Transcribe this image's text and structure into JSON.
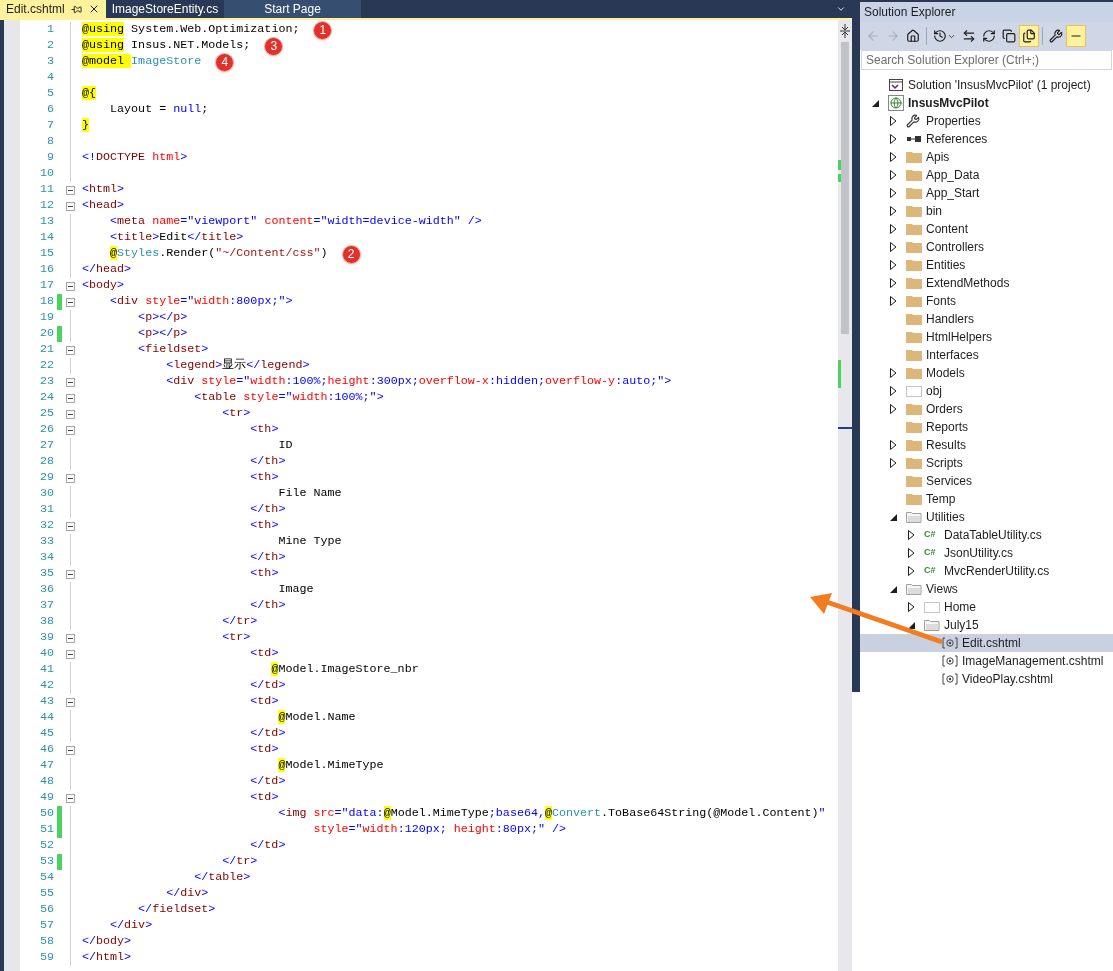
{
  "tabs": [
    {
      "label": "Edit.cshtml",
      "selected": true
    },
    {
      "label": "ImageStoreEntity.cs",
      "selected": false
    },
    {
      "label": "Start Page",
      "selected": false
    }
  ],
  "editor": {
    "lines": [
      {
        "num": "1",
        "fold": false,
        "changed": false,
        "callout": "1",
        "tokens": [
          {
            "kind": "razor",
            "text": "@using"
          },
          {
            "kind": "plain",
            "text": " System.Web.Optimization;"
          }
        ]
      },
      {
        "num": "2",
        "fold": false,
        "changed": false,
        "callout": "3",
        "tokens": [
          {
            "kind": "razor",
            "text": "@using"
          },
          {
            "kind": "plain",
            "text": " Insus.NET.Models;"
          }
        ]
      },
      {
        "num": "3",
        "fold": false,
        "changed": false,
        "callout": "4",
        "tokens": [
          {
            "kind": "razor",
            "text": "@model "
          },
          {
            "kind": "type",
            "text": "ImageStore"
          }
        ]
      },
      {
        "num": "4",
        "fold": false,
        "changed": false
      },
      {
        "num": "5",
        "fold": false,
        "changed": false,
        "tokens": [
          {
            "kind": "razor",
            "text": "@{"
          }
        ]
      },
      {
        "num": "6",
        "fold": false,
        "changed": false,
        "tokens": [
          {
            "kind": "plain",
            "text": "    Layout = "
          },
          {
            "kind": "keyword",
            "text": "null"
          },
          {
            "kind": "plain",
            "text": ";"
          }
        ]
      },
      {
        "num": "7",
        "fold": false,
        "changed": false,
        "tokens": [
          {
            "kind": "razor",
            "text": "}"
          }
        ]
      },
      {
        "num": "8",
        "fold": false,
        "changed": false
      },
      {
        "num": "9",
        "fold": false,
        "changed": false,
        "tokens": [
          {
            "kind": "punct",
            "text": "<!"
          },
          {
            "kind": "element",
            "text": "DOCTYPE"
          },
          {
            "kind": "attr",
            "text": " html"
          },
          {
            "kind": "punct",
            "text": ">"
          }
        ]
      },
      {
        "num": "10",
        "fold": false,
        "changed": false
      },
      {
        "num": "11",
        "fold": true,
        "changed": false,
        "tokens": [
          {
            "kind": "punct",
            "text": "<"
          },
          {
            "kind": "element",
            "text": "html"
          },
          {
            "kind": "punct",
            "text": ">"
          }
        ]
      },
      {
        "num": "12",
        "fold": true,
        "changed": false,
        "tokens": [
          {
            "kind": "punct",
            "text": "<"
          },
          {
            "kind": "element",
            "text": "head"
          },
          {
            "kind": "punct",
            "text": ">"
          }
        ]
      },
      {
        "num": "13",
        "fold": false,
        "changed": false,
        "tokens": [
          {
            "kind": "punct",
            "text": "    <"
          },
          {
            "kind": "element",
            "text": "meta"
          },
          {
            "kind": "attr",
            "text": " name"
          },
          {
            "kind": "punct",
            "text": "="
          },
          {
            "kind": "value",
            "text": "\"viewport\""
          },
          {
            "kind": "attr",
            "text": " content"
          },
          {
            "kind": "punct",
            "text": "="
          },
          {
            "kind": "value",
            "text": "\"width=device-width\""
          },
          {
            "kind": "punct",
            "text": " />"
          }
        ]
      },
      {
        "num": "14",
        "fold": false,
        "changed": false,
        "tokens": [
          {
            "kind": "punct",
            "text": "    <"
          },
          {
            "kind": "element",
            "text": "title"
          },
          {
            "kind": "punct",
            "text": ">"
          },
          {
            "kind": "plain",
            "text": "Edit"
          },
          {
            "kind": "punct",
            "text": "</"
          },
          {
            "kind": "element",
            "text": "title"
          },
          {
            "kind": "punct",
            "text": ">"
          }
        ]
      },
      {
        "num": "15",
        "fold": false,
        "changed": false,
        "callout": "2",
        "tokens": [
          {
            "kind": "razor",
            "text": "    @"
          },
          {
            "kind": "type",
            "text": "Styles"
          },
          {
            "kind": "plain",
            "text": ".Render("
          },
          {
            "kind": "string",
            "text": "\"~/Content/css\""
          },
          {
            "kind": "plain",
            "text": ")"
          }
        ]
      },
      {
        "num": "16",
        "fold": false,
        "changed": false,
        "tokens": [
          {
            "kind": "punct",
            "text": "</"
          },
          {
            "kind": "element",
            "text": "head"
          },
          {
            "kind": "punct",
            "text": ">"
          }
        ]
      },
      {
        "num": "17",
        "fold": true,
        "changed": false,
        "tokens": [
          {
            "kind": "punct",
            "text": "<"
          },
          {
            "kind": "element",
            "text": "body"
          },
          {
            "kind": "punct",
            "text": ">"
          }
        ]
      },
      {
        "num": "18",
        "fold": true,
        "changed": true,
        "tokens": [
          {
            "kind": "punct",
            "text": "    <"
          },
          {
            "kind": "element",
            "text": "div"
          },
          {
            "kind": "attr",
            "text": " style"
          },
          {
            "kind": "punct",
            "text": "="
          },
          {
            "kind": "value",
            "text": "\""
          },
          {
            "kind": "attr",
            "text": "width"
          },
          {
            "kind": "value",
            "text": ":800px;\""
          },
          {
            "kind": "punct",
            "text": ">"
          }
        ]
      },
      {
        "num": "19",
        "fold": false,
        "changed": false,
        "tokens": [
          {
            "kind": "punct",
            "text": "        <"
          },
          {
            "kind": "element",
            "text": "p"
          },
          {
            "kind": "punct",
            "text": "></"
          },
          {
            "kind": "element",
            "text": "p"
          },
          {
            "kind": "punct",
            "text": ">"
          }
        ]
      },
      {
        "num": "20",
        "fold": false,
        "changed": true,
        "tokens": [
          {
            "kind": "punct",
            "text": "        <"
          },
          {
            "kind": "element",
            "text": "p"
          },
          {
            "kind": "punct",
            "text": "></"
          },
          {
            "kind": "element",
            "text": "p"
          },
          {
            "kind": "punct",
            "text": ">"
          }
        ]
      },
      {
        "num": "21",
        "fold": true,
        "changed": false,
        "tokens": [
          {
            "kind": "punct",
            "text": "        <"
          },
          {
            "kind": "element",
            "text": "fieldset"
          },
          {
            "kind": "punct",
            "text": ">"
          }
        ]
      },
      {
        "num": "22",
        "fold": false,
        "changed": false,
        "tokens": [
          {
            "kind": "punct",
            "text": "            <"
          },
          {
            "kind": "element",
            "text": "legend"
          },
          {
            "kind": "punct",
            "text": ">"
          },
          {
            "kind": "plain",
            "text": "显示"
          },
          {
            "kind": "punct",
            "text": "</"
          },
          {
            "kind": "element",
            "text": "legend"
          },
          {
            "kind": "punct",
            "text": ">"
          }
        ]
      },
      {
        "num": "23",
        "fold": true,
        "changed": false,
        "tokens": [
          {
            "kind": "punct",
            "text": "            <"
          },
          {
            "kind": "element",
            "text": "div"
          },
          {
            "kind": "attr",
            "text": " style"
          },
          {
            "kind": "punct",
            "text": "="
          },
          {
            "kind": "value",
            "text": "\""
          },
          {
            "kind": "attr",
            "text": "width"
          },
          {
            "kind": "value",
            "text": ":100%;"
          },
          {
            "kind": "attr",
            "text": "height"
          },
          {
            "kind": "value",
            "text": ":300px;"
          },
          {
            "kind": "attr",
            "text": "overflow-x"
          },
          {
            "kind": "value",
            "text": ":hidden;"
          },
          {
            "kind": "attr",
            "text": "overflow-y"
          },
          {
            "kind": "value",
            "text": ":auto;\""
          },
          {
            "kind": "punct",
            "text": ">"
          }
        ]
      },
      {
        "num": "24",
        "fold": true,
        "changed": false,
        "tokens": [
          {
            "kind": "punct",
            "text": "                <"
          },
          {
            "kind": "element",
            "text": "table"
          },
          {
            "kind": "attr",
            "text": " style"
          },
          {
            "kind": "punct",
            "text": "="
          },
          {
            "kind": "value",
            "text": "\""
          },
          {
            "kind": "attr",
            "text": "width"
          },
          {
            "kind": "value",
            "text": ":100%;\""
          },
          {
            "kind": "punct",
            "text": ">"
          }
        ]
      },
      {
        "num": "25",
        "fold": true,
        "changed": false,
        "tokens": [
          {
            "kind": "punct",
            "text": "                    <"
          },
          {
            "kind": "element",
            "text": "tr"
          },
          {
            "kind": "punct",
            "text": ">"
          }
        ]
      },
      {
        "num": "26",
        "fold": true,
        "changed": false,
        "tokens": [
          {
            "kind": "punct",
            "text": "                        <"
          },
          {
            "kind": "element",
            "text": "th"
          },
          {
            "kind": "punct",
            "text": ">"
          }
        ]
      },
      {
        "num": "27",
        "fold": false,
        "changed": false,
        "tokens": [
          {
            "kind": "plain",
            "text": "                            ID"
          }
        ]
      },
      {
        "num": "28",
        "fold": false,
        "changed": false,
        "tokens": [
          {
            "kind": "punct",
            "text": "                        </"
          },
          {
            "kind": "element",
            "text": "th"
          },
          {
            "kind": "punct",
            "text": ">"
          }
        ]
      },
      {
        "num": "29",
        "fold": true,
        "changed": false,
        "tokens": [
          {
            "kind": "punct",
            "text": "                        <"
          },
          {
            "kind": "element",
            "text": "th"
          },
          {
            "kind": "punct",
            "text": ">"
          }
        ]
      },
      {
        "num": "30",
        "fold": false,
        "changed": false,
        "tokens": [
          {
            "kind": "plain",
            "text": "                            File Name"
          }
        ]
      },
      {
        "num": "31",
        "fold": false,
        "changed": false,
        "tokens": [
          {
            "kind": "punct",
            "text": "                        </"
          },
          {
            "kind": "element",
            "text": "th"
          },
          {
            "kind": "punct",
            "text": ">"
          }
        ]
      },
      {
        "num": "32",
        "fold": true,
        "changed": false,
        "tokens": [
          {
            "kind": "punct",
            "text": "                        <"
          },
          {
            "kind": "element",
            "text": "th"
          },
          {
            "kind": "punct",
            "text": ">"
          }
        ]
      },
      {
        "num": "33",
        "fold": false,
        "changed": false,
        "tokens": [
          {
            "kind": "plain",
            "text": "                            Mine Type"
          }
        ]
      },
      {
        "num": "34",
        "fold": false,
        "changed": false,
        "tokens": [
          {
            "kind": "punct",
            "text": "                        </"
          },
          {
            "kind": "element",
            "text": "th"
          },
          {
            "kind": "punct",
            "text": ">"
          }
        ]
      },
      {
        "num": "35",
        "fold": true,
        "changed": false,
        "tokens": [
          {
            "kind": "punct",
            "text": "                        <"
          },
          {
            "kind": "element",
            "text": "th"
          },
          {
            "kind": "punct",
            "text": ">"
          }
        ]
      },
      {
        "num": "36",
        "fold": false,
        "changed": false,
        "tokens": [
          {
            "kind": "plain",
            "text": "                            Image"
          }
        ]
      },
      {
        "num": "37",
        "fold": false,
        "changed": false,
        "tokens": [
          {
            "kind": "punct",
            "text": "                        </"
          },
          {
            "kind": "element",
            "text": "th"
          },
          {
            "kind": "punct",
            "text": ">"
          }
        ]
      },
      {
        "num": "38",
        "fold": false,
        "changed": false,
        "tokens": [
          {
            "kind": "punct",
            "text": "                    </"
          },
          {
            "kind": "element",
            "text": "tr"
          },
          {
            "kind": "punct",
            "text": ">"
          }
        ]
      },
      {
        "num": "39",
        "fold": true,
        "changed": false,
        "tokens": [
          {
            "kind": "punct",
            "text": "                    <"
          },
          {
            "kind": "element",
            "text": "tr"
          },
          {
            "kind": "punct",
            "text": ">"
          }
        ]
      },
      {
        "num": "40",
        "fold": true,
        "changed": false,
        "tokens": [
          {
            "kind": "punct",
            "text": "                        <"
          },
          {
            "kind": "element",
            "text": "td"
          },
          {
            "kind": "punct",
            "text": ">"
          }
        ]
      },
      {
        "num": "41",
        "fold": false,
        "changed": false,
        "tokens": [
          {
            "kind": "razor",
            "text": "                           @"
          },
          {
            "kind": "plain",
            "text": "Model.ImageStore_nbr"
          }
        ]
      },
      {
        "num": "42",
        "fold": false,
        "changed": false,
        "tokens": [
          {
            "kind": "punct",
            "text": "                        </"
          },
          {
            "kind": "element",
            "text": "td"
          },
          {
            "kind": "punct",
            "text": ">"
          }
        ]
      },
      {
        "num": "43",
        "fold": true,
        "changed": false,
        "tokens": [
          {
            "kind": "punct",
            "text": "                        <"
          },
          {
            "kind": "element",
            "text": "td"
          },
          {
            "kind": "punct",
            "text": ">"
          }
        ]
      },
      {
        "num": "44",
        "fold": false,
        "changed": false,
        "tokens": [
          {
            "kind": "razor",
            "text": "                            @"
          },
          {
            "kind": "plain",
            "text": "Model.Name"
          }
        ]
      },
      {
        "num": "45",
        "fold": false,
        "changed": false,
        "tokens": [
          {
            "kind": "punct",
            "text": "                        </"
          },
          {
            "kind": "element",
            "text": "td"
          },
          {
            "kind": "punct",
            "text": ">"
          }
        ]
      },
      {
        "num": "46",
        "fold": true,
        "changed": false,
        "tokens": [
          {
            "kind": "punct",
            "text": "                        <"
          },
          {
            "kind": "element",
            "text": "td"
          },
          {
            "kind": "punct",
            "text": ">"
          }
        ]
      },
      {
        "num": "47",
        "fold": false,
        "changed": false,
        "tokens": [
          {
            "kind": "razor",
            "text": "                            @"
          },
          {
            "kind": "plain",
            "text": "Model.MimeType"
          }
        ]
      },
      {
        "num": "48",
        "fold": false,
        "changed": false,
        "tokens": [
          {
            "kind": "punct",
            "text": "                        </"
          },
          {
            "kind": "element",
            "text": "td"
          },
          {
            "kind": "punct",
            "text": ">"
          }
        ]
      },
      {
        "num": "49",
        "fold": true,
        "changed": false,
        "tokens": [
          {
            "kind": "punct",
            "text": "                        <"
          },
          {
            "kind": "element",
            "text": "td"
          },
          {
            "kind": "punct",
            "text": ">"
          }
        ]
      },
      {
        "num": "50",
        "fold": false,
        "changed": true,
        "tokens": [
          {
            "kind": "punct",
            "text": "                            <"
          },
          {
            "kind": "element",
            "text": "img"
          },
          {
            "kind": "attr",
            "text": " src"
          },
          {
            "kind": "punct",
            "text": "="
          },
          {
            "kind": "value",
            "text": "\"data:"
          },
          {
            "kind": "razor",
            "text": "@"
          },
          {
            "kind": "plain",
            "text": "Model.MimeType"
          },
          {
            "kind": "value",
            "text": ";base64,"
          },
          {
            "kind": "razor",
            "text": "@"
          },
          {
            "kind": "type",
            "text": "Convert"
          },
          {
            "kind": "plain",
            "text": ".ToBase64String(@Model.Content)"
          },
          {
            "kind": "value",
            "text": "\""
          }
        ]
      },
      {
        "num": "51",
        "fold": false,
        "changed": true,
        "tokens": [
          {
            "kind": "attr",
            "text": "                                 style"
          },
          {
            "kind": "punct",
            "text": "="
          },
          {
            "kind": "value",
            "text": "\""
          },
          {
            "kind": "attr",
            "text": "width"
          },
          {
            "kind": "value",
            "text": ":120px; "
          },
          {
            "kind": "attr",
            "text": "height"
          },
          {
            "kind": "value",
            "text": ":80px;\""
          },
          {
            "kind": "punct",
            "text": " />"
          }
        ]
      },
      {
        "num": "52",
        "fold": false,
        "changed": false,
        "tokens": [
          {
            "kind": "punct",
            "text": "                        </"
          },
          {
            "kind": "element",
            "text": "td"
          },
          {
            "kind": "punct",
            "text": ">"
          }
        ]
      },
      {
        "num": "53",
        "fold": false,
        "changed": true,
        "tokens": [
          {
            "kind": "punct",
            "text": "                    </"
          },
          {
            "kind": "element",
            "text": "tr"
          },
          {
            "kind": "punct",
            "text": ">"
          }
        ]
      },
      {
        "num": "54",
        "fold": false,
        "changed": false,
        "tokens": [
          {
            "kind": "punct",
            "text": "                </"
          },
          {
            "kind": "element",
            "text": "table"
          },
          {
            "kind": "punct",
            "text": ">"
          }
        ]
      },
      {
        "num": "55",
        "fold": false,
        "changed": false,
        "tokens": [
          {
            "kind": "punct",
            "text": "            </"
          },
          {
            "kind": "element",
            "text": "div"
          },
          {
            "kind": "punct",
            "text": ">"
          }
        ]
      },
      {
        "num": "56",
        "fold": false,
        "changed": false,
        "tokens": [
          {
            "kind": "punct",
            "text": "        </"
          },
          {
            "kind": "element",
            "text": "fieldset"
          },
          {
            "kind": "punct",
            "text": ">"
          }
        ]
      },
      {
        "num": "57",
        "fold": false,
        "changed": false,
        "tokens": [
          {
            "kind": "punct",
            "text": "    </"
          },
          {
            "kind": "element",
            "text": "div"
          },
          {
            "kind": "punct",
            "text": ">"
          }
        ]
      },
      {
        "num": "58",
        "fold": false,
        "changed": false,
        "tokens": [
          {
            "kind": "punct",
            "text": "</"
          },
          {
            "kind": "element",
            "text": "body"
          },
          {
            "kind": "punct",
            "text": ">"
          }
        ]
      },
      {
        "num": "59",
        "fold": false,
        "changed": false,
        "tokens": [
          {
            "kind": "punct",
            "text": "</"
          },
          {
            "kind": "element",
            "text": "html"
          },
          {
            "kind": "punct",
            "text": ">"
          }
        ]
      }
    ]
  },
  "solution_explorer": {
    "title": "Solution Explorer",
    "toolbar": [
      {
        "kind": "back",
        "disabled": true,
        "on": false
      },
      {
        "kind": "forward",
        "disabled": true,
        "on": false
      },
      {
        "kind": "home",
        "disabled": false,
        "on": false
      },
      {
        "kind": "separator"
      },
      {
        "kind": "pending-changes",
        "disabled": false,
        "on": false
      },
      {
        "kind": "sync",
        "disabled": false,
        "on": false
      },
      {
        "kind": "refresh",
        "disabled": false,
        "on": false
      },
      {
        "kind": "collapse-all",
        "disabled": false,
        "on": false
      },
      {
        "kind": "show-all-files",
        "disabled": false,
        "on": true
      },
      {
        "kind": "separator"
      },
      {
        "kind": "properties",
        "disabled": false,
        "on": false
      },
      {
        "kind": "preview",
        "disabled": false,
        "on": true
      }
    ],
    "search": {
      "placeholder": "Search Solution Explorer (Ctrl+;)"
    },
    "tree": [
      {
        "label": "Solution 'InsusMvcPilot' (1 project)",
        "kind": "solution",
        "selected": false
      },
      {
        "label": "InsusMvcPilot",
        "kind": "project",
        "expanded": true,
        "selected": false,
        "children": [
          {
            "label": "Properties",
            "kind": "properties",
            "expanded": false,
            "selected": false
          },
          {
            "label": "References",
            "kind": "references",
            "expanded": false,
            "selected": false
          },
          {
            "label": "Apis",
            "kind": "folder",
            "expanded": false,
            "selected": false
          },
          {
            "label": "App_Data",
            "kind": "folder",
            "expanded": false,
            "selected": false
          },
          {
            "label": "App_Start",
            "kind": "folder",
            "expanded": false,
            "selected": false
          },
          {
            "label": "bin",
            "kind": "folder",
            "expanded": false,
            "selected": false
          },
          {
            "label": "Content",
            "kind": "folder",
            "expanded": false,
            "selected": false
          },
          {
            "label": "Controllers",
            "kind": "folder",
            "expanded": false,
            "selected": false
          },
          {
            "label": "Entities",
            "kind": "folder",
            "expanded": false,
            "selected": false
          },
          {
            "label": "ExtendMethods",
            "kind": "folder",
            "expanded": false,
            "selected": false
          },
          {
            "label": "Fonts",
            "kind": "folder",
            "expanded": false,
            "selected": false
          },
          {
            "label": "Handlers",
            "kind": "folder",
            "selected": false
          },
          {
            "label": "HtmlHelpers",
            "kind": "folder",
            "selected": false
          },
          {
            "label": "Interfaces",
            "kind": "folder",
            "selected": false
          },
          {
            "label": "Models",
            "kind": "folder",
            "expanded": false,
            "selected": false
          },
          {
            "label": "obj",
            "kind": "hidden-folder",
            "expanded": false,
            "selected": false
          },
          {
            "label": "Orders",
            "kind": "folder",
            "expanded": false,
            "selected": false
          },
          {
            "label": "Reports",
            "kind": "folder",
            "selected": false
          },
          {
            "label": "Results",
            "kind": "folder",
            "expanded": false,
            "selected": false
          },
          {
            "label": "Scripts",
            "kind": "folder",
            "expanded": false,
            "selected": false
          },
          {
            "label": "Services",
            "kind": "folder",
            "selected": false
          },
          {
            "label": "Temp",
            "kind": "folder",
            "selected": false
          },
          {
            "label": "Utilities",
            "kind": "open-folder",
            "expanded": true,
            "selected": false,
            "children": [
              {
                "label": "DataTableUtility.cs",
                "kind": "csharp",
                "icon_text": "C#",
                "expanded": false,
                "selected": false
              },
              {
                "label": "JsonUtility.cs",
                "kind": "csharp",
                "icon_text": "C#",
                "expanded": false,
                "selected": false
              },
              {
                "label": "MvcRenderUtility.cs",
                "kind": "csharp",
                "icon_text": "C#",
                "expanded": false,
                "selected": false
              }
            ]
          },
          {
            "label": "Views",
            "kind": "open-folder",
            "expanded": true,
            "selected": false,
            "children": [
              {
                "label": "Home",
                "kind": "hidden-folder",
                "expanded": false,
                "selected": false
              },
              {
                "label": "July15",
                "kind": "open-folder",
                "expanded": true,
                "selected": false,
                "children": [
                  {
                    "label": "Edit.cshtml",
                    "kind": "razor",
                    "selected": true
                  },
                  {
                    "label": "ImageManagement.cshtml",
                    "kind": "razor",
                    "selected": false
                  },
                  {
                    "label": "VideoPlay.cshtml",
                    "kind": "razor",
                    "selected": false
                  }
                ]
              }
            ]
          }
        ]
      }
    ]
  }
}
